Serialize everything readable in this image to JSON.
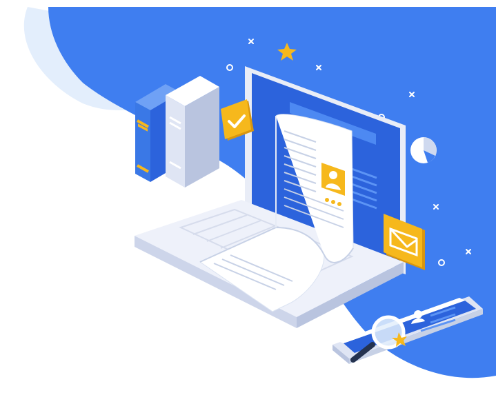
{
  "illustration": {
    "subject": "isometric-laptop-document",
    "colors": {
      "background": "#ffffff",
      "blob_blue": "#3f7ef0",
      "blob_light": "#e3eefc",
      "screen_blue": "#2c63dc",
      "screen_dark": "#1f4fc0",
      "laptop_body": "#dfe5f4",
      "laptop_top": "#eef1fa",
      "paper": "#ffffff",
      "paper_shadow": "#dbe3f2",
      "accent_yellow": "#f6b81c",
      "accent_yellow_dark": "#d9960f",
      "book_blue": "#3a78e6",
      "book_grey": "#cdd6ea"
    },
    "icons": [
      "star-icon",
      "checkmark-icon",
      "user-profile-icon",
      "envelope-icon",
      "pie-chart-icon",
      "magnifier-icon",
      "document-icon"
    ]
  }
}
